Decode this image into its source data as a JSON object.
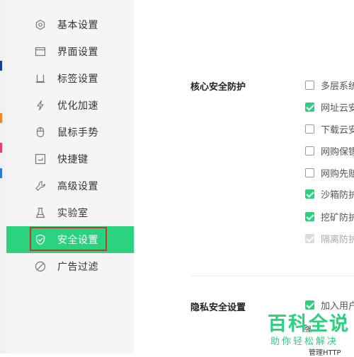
{
  "sidebar": {
    "items": [
      {
        "label": "基本设置",
        "icon": "hexagon-settings-icon"
      },
      {
        "label": "界面设置",
        "icon": "window-icon"
      },
      {
        "label": "标签设置",
        "icon": "tab-icon"
      },
      {
        "label": "优化加速",
        "icon": "lightning-icon"
      },
      {
        "label": "鼠标手势",
        "icon": "mouse-icon"
      },
      {
        "label": "快捷键",
        "icon": "keyboard-shortcut-icon"
      },
      {
        "label": "高级设置",
        "icon": "wrench-icon"
      },
      {
        "label": "实验室",
        "icon": "flask-icon"
      },
      {
        "label": "安全设置",
        "icon": "shield-icon",
        "active": true
      },
      {
        "label": "广告过滤",
        "icon": "no-ads-icon"
      }
    ]
  },
  "core_security": {
    "title": "核心安全防护",
    "options": [
      {
        "label": "多层系统",
        "checked": false
      },
      {
        "label": "网址云安",
        "checked": true
      },
      {
        "label": "下载云安",
        "checked": false
      },
      {
        "label": "网购保镖",
        "checked": false
      },
      {
        "label": "网购先赔",
        "checked": false
      },
      {
        "label": "沙箱防护",
        "checked": true
      },
      {
        "label": "挖矿防护",
        "checked": true
      },
      {
        "label": "隔离防护",
        "checked": true,
        "disabled": true
      }
    ]
  },
  "privacy_security": {
    "title": "隐私安全设置",
    "options": [
      {
        "label": "加入用户",
        "checked": true
      }
    ]
  },
  "watermark": {
    "title": "百科全说",
    "subtitle": "助你轻松解决"
  },
  "clipped_text": {
    "line1": "管理HTTP",
    "line2": "强"
  },
  "colors": {
    "accent": "#2ad17e",
    "highlight_border": "#c0392b"
  }
}
